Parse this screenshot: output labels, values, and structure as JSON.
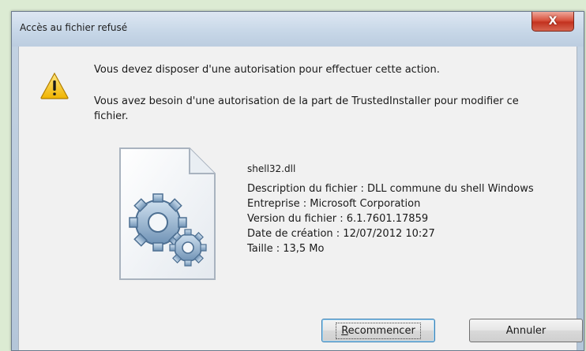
{
  "window": {
    "title": "Accès au fichier refusé",
    "close_label": "X"
  },
  "message": {
    "line1": "Vous devez disposer d'une autorisation pour effectuer cette action.",
    "line2": "Vous avez besoin d'une autorisation de la part de TrustedInstaller pour modifier ce fichier."
  },
  "file": {
    "name": "shell32.dll",
    "description": "Description du fichier : DLL commune du shell Windows",
    "company": "Entreprise : Microsoft Corporation",
    "version": "Version du fichier : 6.1.7601.17859",
    "created": "Date de création : 12/07/2012 10:27",
    "size": "Taille : 13,5 Mo"
  },
  "buttons": {
    "retry_first": "R",
    "retry_rest": "ecommencer",
    "cancel": "Annuler"
  },
  "icons": {
    "warning": "warning-icon",
    "file": "dll-file-gears-icon"
  }
}
